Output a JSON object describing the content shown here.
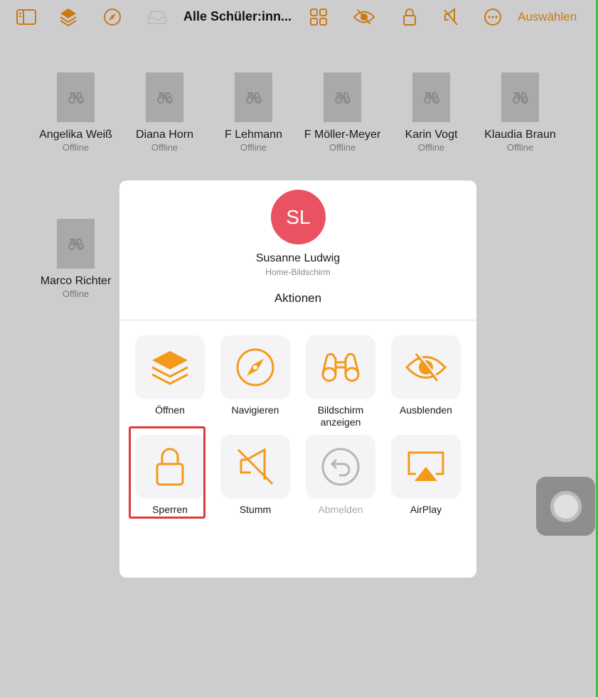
{
  "toolbar": {
    "title": "Alle Schüler:inn...",
    "select_label": "Auswählen",
    "accent": "#c97a12",
    "icons": [
      "sidebar-icon",
      "layers-icon",
      "compass-icon",
      "tray-icon",
      "grid-icon",
      "eye-slash-icon",
      "lock-icon",
      "mute-icon",
      "more-icon"
    ]
  },
  "students": [
    {
      "name": "Angelika Weiß",
      "status": "Offline"
    },
    {
      "name": "Diana Horn",
      "status": "Offline"
    },
    {
      "name": "F Lehmann",
      "status": "Offline"
    },
    {
      "name": "F Möller-Meyer",
      "status": "Offline"
    },
    {
      "name": "Karin Vogt",
      "status": "Offline"
    },
    {
      "name": "Klaudia Braun",
      "status": "Offline"
    },
    {
      "name": "Marco Richter",
      "status": "Offline"
    }
  ],
  "modal": {
    "initials": "SL",
    "avatar_color": "#ea5261",
    "name": "Susanne Ludwig",
    "subtitle": "Home-Bildschirm",
    "heading": "Aktionen",
    "actions": [
      {
        "label": "Öffnen",
        "icon": "layers-icon"
      },
      {
        "label": "Navigieren",
        "icon": "compass-icon"
      },
      {
        "label": "Bildschirm anzeigen",
        "icon": "binoculars-icon"
      },
      {
        "label": "Ausblenden",
        "icon": "eye-slash-icon"
      },
      {
        "label": "Sperren",
        "icon": "lock-icon",
        "highlighted": true
      },
      {
        "label": "Stumm",
        "icon": "mute-icon"
      },
      {
        "label": "Abmelden",
        "icon": "logout-icon",
        "disabled": true
      },
      {
        "label": "AirPlay",
        "icon": "airplay-icon"
      }
    ]
  }
}
